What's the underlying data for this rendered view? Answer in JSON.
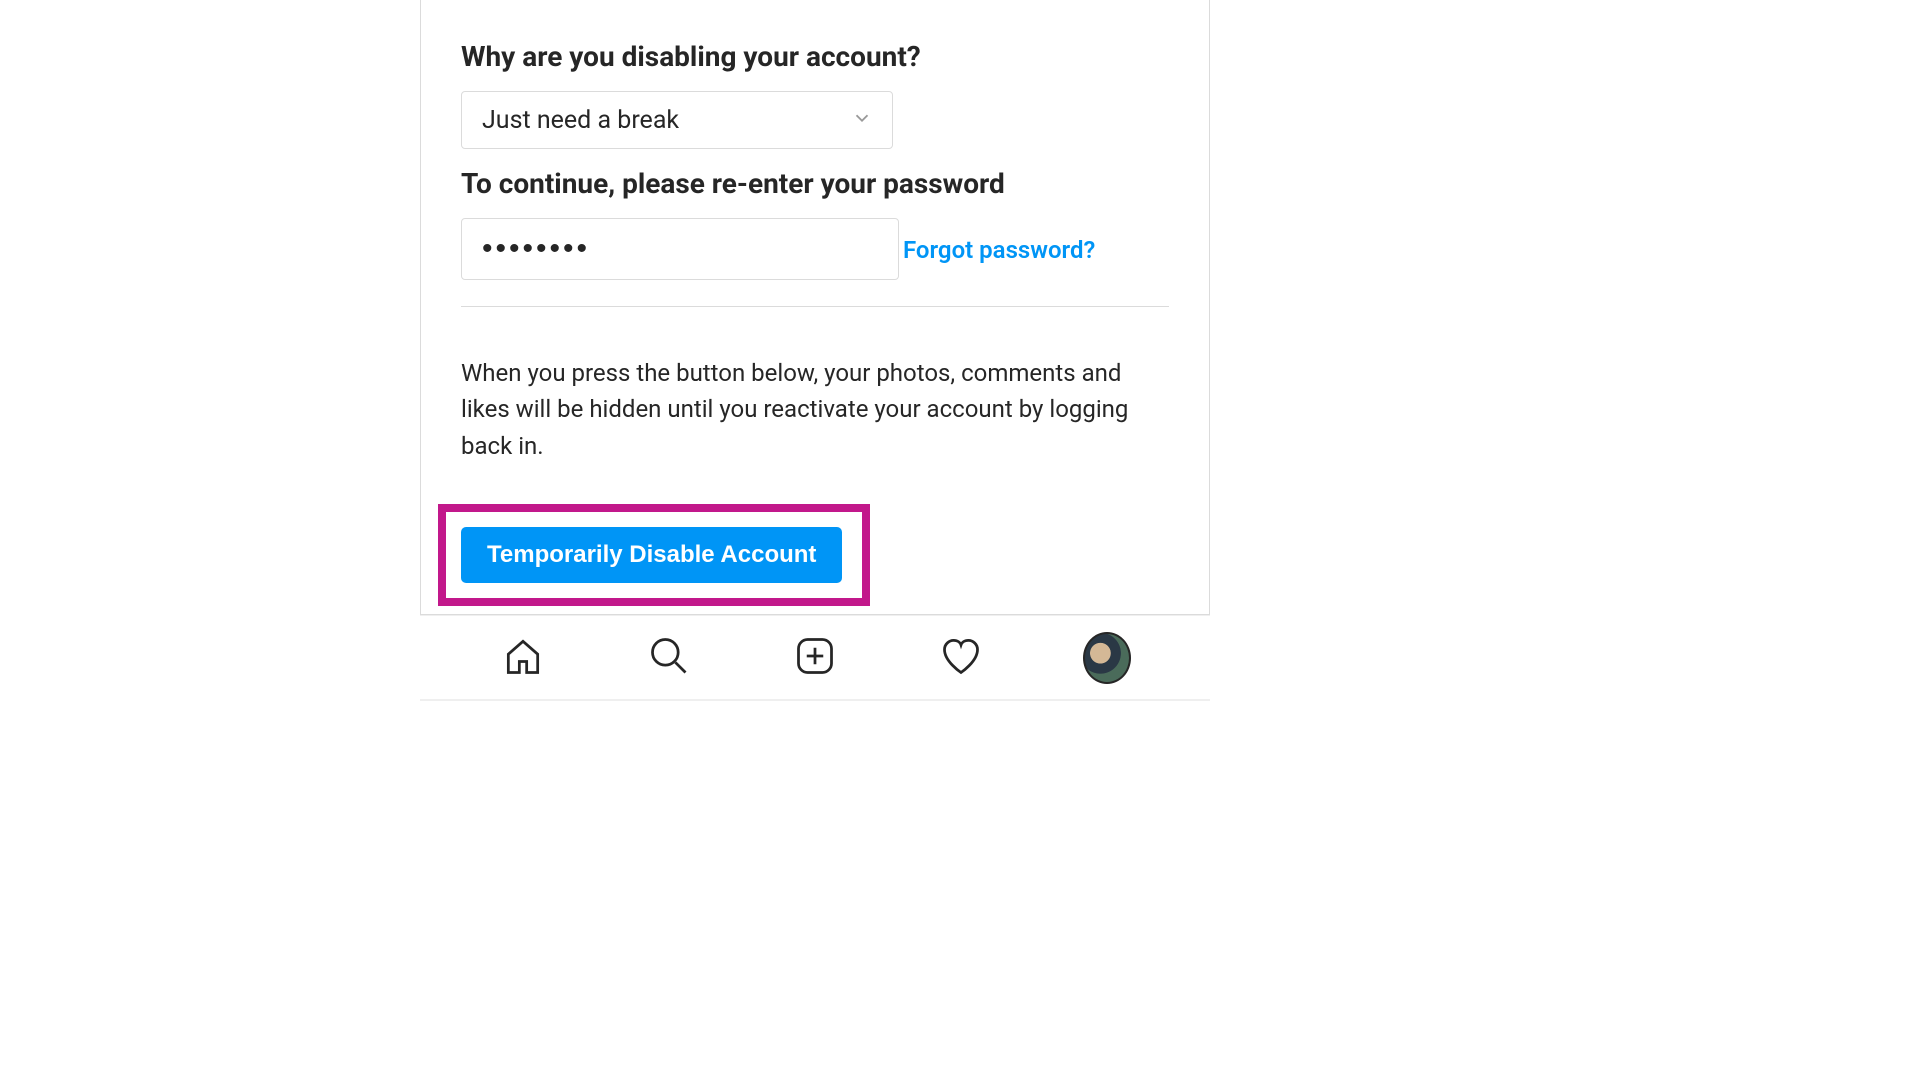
{
  "form": {
    "reason_heading": "Why are you disabling your account?",
    "reason_selected": "Just need a break",
    "password_heading": "To continue, please re-enter your password",
    "password_value": "••••••••",
    "forgot_link_label": "Forgot password?",
    "info_text": "When you press the button below, your photos, comments and likes will be hidden until you reactivate your account by logging back in.",
    "disable_button_label": "Temporarily Disable Account"
  },
  "colors": {
    "accent": "#0095f6",
    "highlight": "#c2188b",
    "border": "#dbdbdb",
    "text": "#262626"
  },
  "nav": {
    "home": "home-icon",
    "search": "search-icon",
    "create": "plus-icon",
    "activity": "heart-icon",
    "profile": "avatar"
  }
}
